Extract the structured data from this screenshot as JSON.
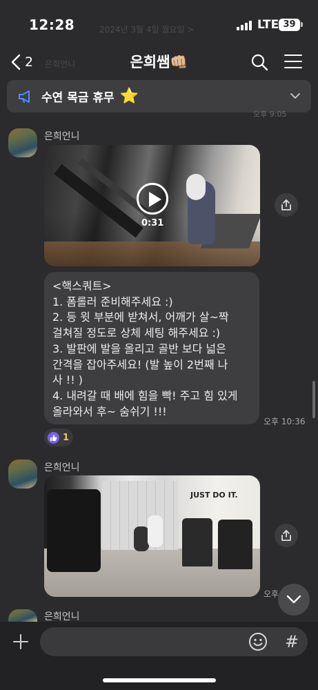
{
  "status_bar": {
    "time": "12:28",
    "network": "LTE",
    "battery": "39",
    "ghost_date": "2024년 3월 4일 월요일 >"
  },
  "header": {
    "back_count": "2",
    "title": "은희쌤👊🏼",
    "ghost_sender": "은희언니"
  },
  "notice": {
    "text": "수연 목금 휴무",
    "emoji": "⭐",
    "ghost_time": "오후 9:05"
  },
  "messages": [
    {
      "sender": "은희언니",
      "video_duration": "0:31",
      "text_lines": [
        "<핵스쿼트>",
        "1. 폼롤러 준비해주세요 :)",
        "2. 등 윗 부분에 받쳐서, 어깨가 살~짝",
        "걸쳐질 정도로 상체 세팅 해주세요 :)",
        "3. 발판에 발을 올리고 골반 보다 넓은",
        "간격을 잡아주세요! (발 높이 2번째 나",
        "사 !! )",
        "4. 내려갈 때 배에 힘을 빡! 주고 힘 있게",
        "올라와서 후~ 숨쉬기 !!!"
      ],
      "time": "오후 10:36",
      "reaction_count": "1"
    },
    {
      "sender": "은희언니",
      "image_sign": "JUST DO IT.",
      "time": "오후"
    },
    {
      "sender": "은희언니"
    }
  ],
  "input": {
    "placeholder": "",
    "hash_label": "#"
  },
  "colors": {
    "background": "#2b2b2d",
    "bubble": "#3e3e41",
    "reaction": "#7b5ff0",
    "star": "#f6c528"
  }
}
